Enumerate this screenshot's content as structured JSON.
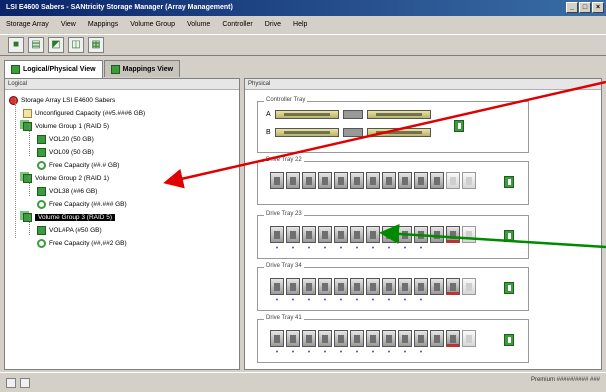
{
  "window": {
    "title": "LSI E4600 Sabers - SANtricity Storage Manager (Array Management)",
    "controls": [
      "_",
      "□",
      "×"
    ]
  },
  "menu": [
    "Storage Array",
    "View",
    "Mappings",
    "Volume Group",
    "Volume",
    "Controller",
    "Drive",
    "Help"
  ],
  "toolbar": [
    {
      "name": "toolbar-btn-1",
      "glyph": "■"
    },
    {
      "name": "toolbar-btn-2",
      "glyph": "▤"
    },
    {
      "name": "toolbar-btn-3",
      "glyph": "◩"
    },
    {
      "name": "toolbar-btn-4",
      "glyph": "◫"
    },
    {
      "name": "toolbar-btn-5",
      "glyph": "▦"
    }
  ],
  "tabs": [
    {
      "label": "Logical/Physical View",
      "active": true
    },
    {
      "label": "Mappings View",
      "active": false
    }
  ],
  "logical": {
    "header": "Logical",
    "tree": [
      {
        "label": "Storage Array LSI E4600 Sabers",
        "icon": "red",
        "indent": 0
      },
      {
        "label": "Unconfigured Capacity (##5.###6 GB)",
        "icon": "tan",
        "indent": 1
      },
      {
        "label": "Volume Group 1 (RAID 5)",
        "icon": "vg",
        "indent": 1
      },
      {
        "label": "VOL20 (50 GB)",
        "icon": "green",
        "indent": 2
      },
      {
        "label": "VOL09 (50 GB)",
        "icon": "green",
        "indent": 2
      },
      {
        "label": "Free Capacity (##.# GB)",
        "icon": "free",
        "indent": 2
      },
      {
        "label": "Volume Group 2 (RAID 1)",
        "icon": "vg",
        "indent": 1
      },
      {
        "label": "VOL38 (##6 GB)",
        "icon": "green",
        "indent": 2
      },
      {
        "label": "Free Capacity (##.### GB)",
        "icon": "free",
        "indent": 2
      },
      {
        "label": "Volume Group 3 (RAID 5)",
        "icon": "vg",
        "indent": 1,
        "selected": true
      },
      {
        "label": "VOL#PA (#50 GB)",
        "icon": "green",
        "indent": 2
      },
      {
        "label": "Free Capacity (##,##2 GB)",
        "icon": "free",
        "indent": 2
      }
    ]
  },
  "physical": {
    "header": "Physical",
    "controller_tray": {
      "title": "Controller Tray",
      "rows": [
        "A",
        "B"
      ]
    },
    "drive_trays": [
      {
        "title": "Drive Tray 22",
        "drives": [
          "d",
          "d",
          "d",
          "d",
          "d",
          "d",
          "d",
          "d",
          "d",
          "d",
          "d",
          "l",
          "l"
        ],
        "dots": false
      },
      {
        "title": "Drive Tray 23",
        "drives": [
          "d",
          "d",
          "d",
          "d",
          "d",
          "d",
          "d",
          "d",
          "d",
          "d",
          "d",
          "r",
          "l"
        ],
        "dots": true
      },
      {
        "title": "Drive Tray 34",
        "drives": [
          "d",
          "d",
          "d",
          "d",
          "d",
          "d",
          "d",
          "d",
          "d",
          "d",
          "d",
          "r",
          "l"
        ],
        "dots": true
      },
      {
        "title": "Drive Tray 41",
        "drives": [
          "d",
          "d",
          "d",
          "d",
          "d",
          "d",
          "d",
          "d",
          "d",
          "d",
          "d",
          "r",
          "l"
        ],
        "dots": true
      }
    ]
  },
  "status": {
    "text": "Premium #####/#### ###"
  },
  "annotations": {
    "red_color": "#e00000",
    "green_color": "#008a00"
  }
}
